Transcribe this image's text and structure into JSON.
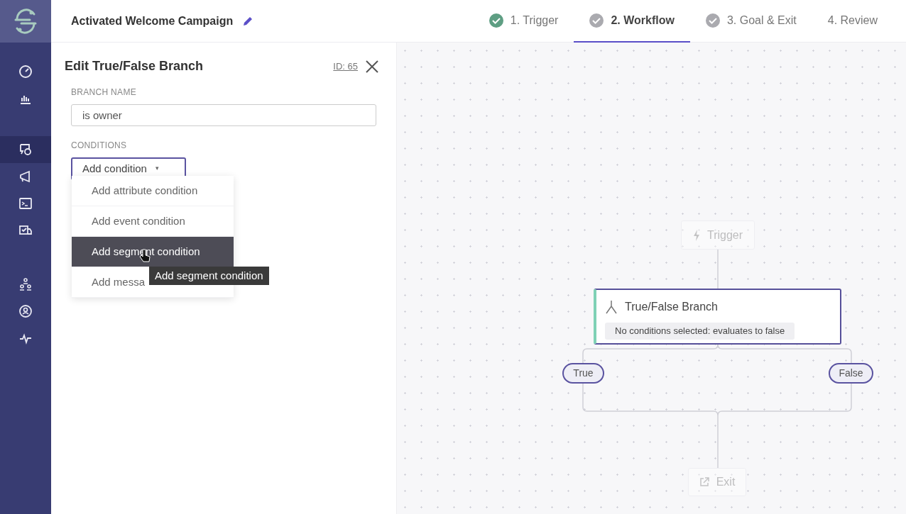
{
  "header": {
    "title": "Activated Welcome Campaign",
    "steps": [
      {
        "kind": "done",
        "label": "1. Trigger",
        "selected": false
      },
      {
        "kind": "visited",
        "label": "2. Workflow",
        "selected": true
      },
      {
        "kind": "visited",
        "label": "3. Goal & Exit",
        "selected": false
      },
      {
        "kind": "todo",
        "label": "4. Review",
        "selected": false
      }
    ]
  },
  "sidebar": {
    "items": [
      {
        "selected": false
      },
      {
        "selected": false
      },
      {
        "selected": true
      },
      {
        "selected": false
      },
      {
        "selected": false
      },
      {
        "selected": false
      },
      {
        "selected": false
      },
      {
        "selected": false
      },
      {
        "selected": false
      }
    ]
  },
  "panel": {
    "title": "Edit True/False Branch",
    "id_link": "ID: 65",
    "branch_name_label": "BRANCH NAME",
    "branch_name": "is owner",
    "conditions_label": "CONDITIONS",
    "add_button": "Add condition",
    "caret": "▾",
    "menu": [
      {
        "label": "Add attribute condition",
        "selected": false
      },
      {
        "label": "Add event condition",
        "selected": false
      },
      {
        "label": "Add segment condition",
        "selected": true
      },
      {
        "label": "Add messa",
        "selected": false
      }
    ],
    "tooltip": "Add segment condition"
  },
  "canvas": {
    "trigger": {
      "label": "Trigger",
      "disabled": true
    },
    "branch": {
      "title": "True/False Branch",
      "summary": "No conditions selected: evaluates to false"
    },
    "outcomes": [
      "True",
      "False"
    ],
    "exit": {
      "label": "Exit",
      "disabled": true
    }
  }
}
